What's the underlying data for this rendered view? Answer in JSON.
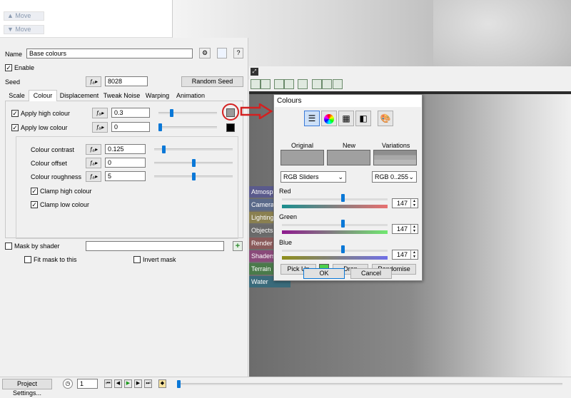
{
  "move_panel": {
    "move_up_label": "Move",
    "move_down_label": "Move"
  },
  "panel": {
    "name_label": "Name",
    "name_value": "Base colours",
    "enable_label": "Enable",
    "seed_label": "Seed",
    "seed_value": "8028",
    "random_seed_label": "Random Seed",
    "tabs": [
      {
        "label": "Scale"
      },
      {
        "label": "Colour"
      },
      {
        "label": "Displacement"
      },
      {
        "label": "Tweak Noise"
      },
      {
        "label": "Warping"
      },
      {
        "label": "Animation"
      }
    ],
    "active_tab": "Colour",
    "apply_high_label": "Apply high colour",
    "apply_high_value": "0.3",
    "apply_high_slider": 0.22,
    "high_colour": "#9a9a9a",
    "apply_low_label": "Apply low colour",
    "apply_low_value": "0",
    "apply_low_slider": 0.0,
    "low_colour": "#000000",
    "contrast_label": "Colour contrast",
    "contrast_value": "0.125",
    "contrast_slider": 0.12,
    "offset_label": "Colour offset",
    "offset_value": "0",
    "offset_slider": 0.5,
    "roughness_label": "Colour roughness",
    "roughness_value": "5",
    "roughness_slider": 0.5,
    "clamp_high_label": "Clamp high colour",
    "clamp_low_label": "Clamp low colour",
    "mask_label": "Mask by shader",
    "fit_mask_label": "Fit mask to this",
    "invert_mask_label": "Invert mask"
  },
  "side_tabs": [
    {
      "label": "Atmosph",
      "color": "#5a5a8c"
    },
    {
      "label": "Camera",
      "color": "#5a6a8a"
    },
    {
      "label": "Lighting",
      "color": "#8a8050"
    },
    {
      "label": "Objects",
      "color": "#6a6a6a"
    },
    {
      "label": "Render",
      "color": "#8a5a5a"
    },
    {
      "label": "Shaders",
      "color": "#8a4a7a"
    },
    {
      "label": "Terrain",
      "color": "#4a7a4a"
    },
    {
      "label": "Water",
      "color": "#3a6a7a"
    }
  ],
  "dialog": {
    "title": "Colours",
    "original_label": "Original",
    "new_label": "New",
    "variations_label": "Variations",
    "mode_select": "RGB Sliders",
    "range_select": "RGB 0..255",
    "red_label": "Red",
    "red_value": "147",
    "red_slider": 0.576,
    "green_label": "Green",
    "green_value": "147",
    "green_slider": 0.576,
    "blue_label": "Blue",
    "blue_value": "147",
    "blue_slider": 0.576,
    "pickup_label": "Pick Up",
    "pick_colour": "#4ccf4c",
    "drop_label": "Drop",
    "randomise_label": "Randomise",
    "ok_label": "OK",
    "cancel_label": "Cancel"
  },
  "bottom": {
    "project_settings_label": "Project Settings...",
    "frame_value": "1"
  }
}
